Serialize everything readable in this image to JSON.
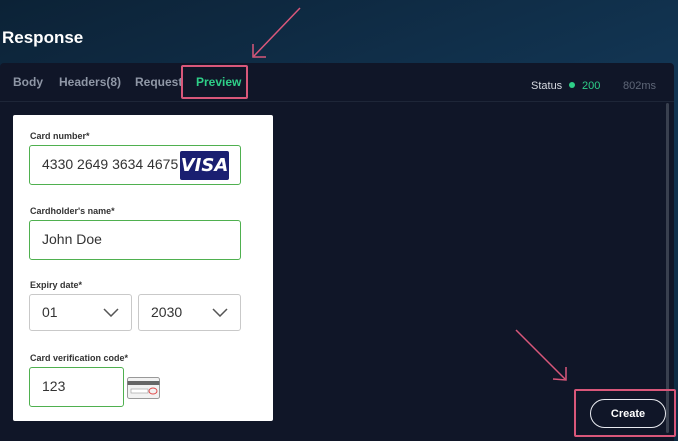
{
  "heading": "Response",
  "tabs": [
    {
      "label": "Body"
    },
    {
      "label": "Headers(8)"
    },
    {
      "label": "Request"
    },
    {
      "label": "Preview",
      "active": true
    }
  ],
  "status": {
    "label": "Status",
    "code": "200",
    "time": "802ms",
    "color": "#2ecf88"
  },
  "form": {
    "card_number": {
      "label": "Card number*",
      "value": "4330 2649 3634 4675",
      "brand": "VISA"
    },
    "cardholder": {
      "label": "Cardholder's name*",
      "value": "John Doe"
    },
    "expiry": {
      "label": "Expiry date*",
      "month": "01",
      "year": "2030"
    },
    "cvc": {
      "label": "Card verification code*",
      "value": "123"
    }
  },
  "create_button": {
    "label": "Create"
  },
  "colors": {
    "accent": "#2ecf88",
    "highlight": "#d9577a",
    "visa": "#1a1f71",
    "field_border": "#4fb04f"
  },
  "icons": [
    "visa-logo-icon",
    "chevron-down-icon",
    "card-cvc-icon",
    "arrow-icon",
    "status-dot-icon"
  ]
}
